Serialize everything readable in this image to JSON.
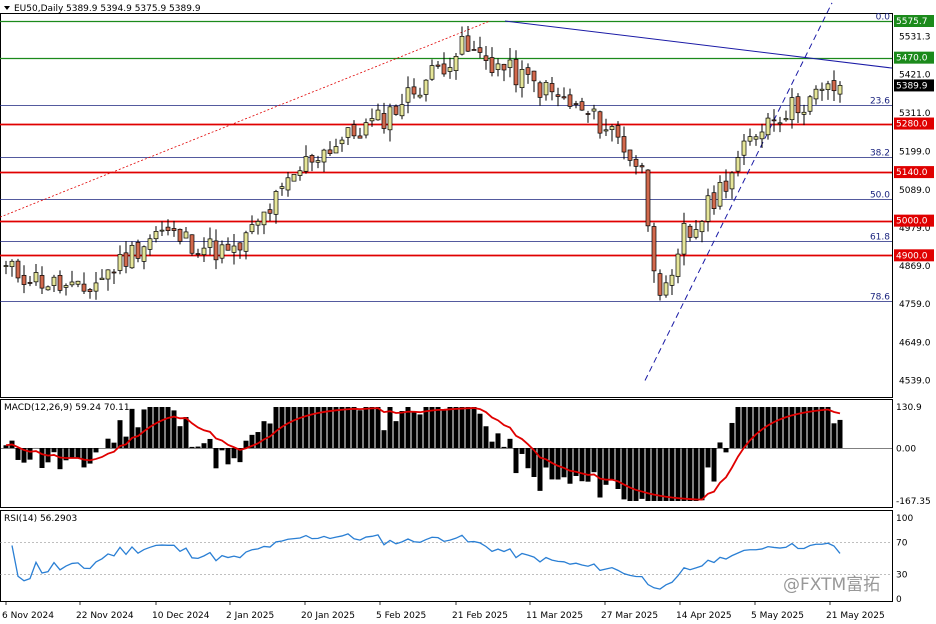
{
  "header": {
    "symbol": "EU50,Daily",
    "ohlc": "5389.9 5394.9 5375.9 5389.9"
  },
  "watermark": "@FXTM富拓",
  "price_axis": {
    "ticks": [
      "5531.3",
      "5421.0",
      "5311.0",
      "5199.0",
      "5089.0",
      "4979.0",
      "4869.0",
      "4759.0",
      "4649.0",
      "4539.0"
    ],
    "badges": [
      {
        "label": "5575.7",
        "color": "#1b8a1b"
      },
      {
        "label": "5470.0",
        "color": "#1b8a1b"
      },
      {
        "label": "5389.9",
        "color": "#000000"
      },
      {
        "label": "5280.0",
        "color": "#e00000"
      },
      {
        "label": "5140.0",
        "color": "#e00000"
      },
      {
        "label": "5000.0",
        "color": "#e00000"
      },
      {
        "label": "4900.0",
        "color": "#e00000"
      }
    ]
  },
  "fib_labels": [
    "0.0",
    "23.6",
    "38.2",
    "50.0",
    "61.8",
    "78.6"
  ],
  "macd": {
    "label": "MACD(12,26,9) 59.24 70.11",
    "ticks": [
      "130.9",
      "0.00",
      "-167.35"
    ]
  },
  "rsi": {
    "label": "RSI(14) 56.2903",
    "ticks": [
      "100",
      "70",
      "30",
      "0"
    ]
  },
  "x_axis": {
    "labels": [
      "6 Nov 2024",
      "22 Nov 2024",
      "10 Dec 2024",
      "2 Jan 2025",
      "20 Jan 2025",
      "5 Feb 2025",
      "21 Feb 2025",
      "11 Mar 2025",
      "27 Mar 2025",
      "14 Apr 2025",
      "5 May 2025",
      "21 May 2025"
    ]
  },
  "colors": {
    "up_candle": "#e6e699",
    "down_candle": "#d2694d",
    "support": "#e00000",
    "resistance": "#1b8a1b",
    "fib": "#1a237e",
    "trend": "#1a1aa6",
    "macd_signal": "#e00000",
    "rsi_line": "#2a7fd4"
  },
  "chart_data": {
    "type": "candlestick",
    "symbol": "EU50",
    "timeframe": "Daily",
    "last_bar": {
      "open": 5389.9,
      "high": 5394.9,
      "low": 5375.9,
      "close": 5389.9
    },
    "key_levels": {
      "resistance": [
        5575.7,
        5470.0
      ],
      "support": [
        5280.0,
        5140.0,
        5000.0,
        4900.0
      ]
    },
    "fibonacci": [
      {
        "level": "0.0",
        "price": 5575.7
      },
      {
        "level": "23.6",
        "price": 5333
      },
      {
        "level": "38.2",
        "price": 5183
      },
      {
        "level": "50.0",
        "price": 5062
      },
      {
        "level": "61.8",
        "price": 4941
      },
      {
        "level": "78.6",
        "price": 4768
      }
    ],
    "price_path": [
      {
        "date": "6 Nov 2024",
        "close": 4860
      },
      {
        "date": "22 Nov 2024",
        "close": 4790
      },
      {
        "date": "10 Dec 2024",
        "close": 4970
      },
      {
        "date": "2 Jan 2025",
        "close": 4900
      },
      {
        "date": "20 Jan 2025",
        "close": 5180
      },
      {
        "date": "5 Feb 2025",
        "close": 5300
      },
      {
        "date": "21 Feb 2025",
        "close": 5500
      },
      {
        "date": "11 Mar 2025",
        "close": 5390
      },
      {
        "date": "27 Mar 2025",
        "close": 5260
      },
      {
        "date": "14 Apr 2025",
        "close": 4950
      },
      {
        "date": "5 May 2025",
        "close": 5290
      },
      {
        "date": "21 May 2025",
        "close": 5389.9
      }
    ],
    "macd": {
      "params": "12,26,9",
      "value": 59.24,
      "signal": 70.11,
      "ylim": [
        -167.35,
        130.9
      ]
    },
    "rsi": {
      "period": 14,
      "value": 56.2903,
      "levels": [
        70,
        30
      ],
      "ylim": [
        0,
        100
      ]
    }
  }
}
